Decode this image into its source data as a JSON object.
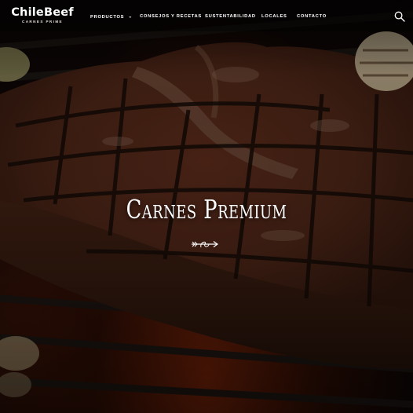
{
  "brand": {
    "name": "ChileBeef",
    "tagline": "CARNES PRIME"
  },
  "nav": {
    "items": [
      {
        "label": "PRODUCTOS",
        "has_dropdown": true
      },
      {
        "label": "CONSEJOS Y RECETAS",
        "has_dropdown": false
      },
      {
        "label": "SUSTENTABILIDAD",
        "has_dropdown": false
      },
      {
        "label": "LOCALES",
        "has_dropdown": false
      },
      {
        "label": "CONTACTO",
        "has_dropdown": false
      }
    ],
    "dropdown_icon": "chevron-down-icon",
    "search_icon": "search-icon"
  },
  "hero": {
    "title": "Carnes Premium",
    "ornament_icon": "arrow-flourish-icon",
    "background": "grilled-t-bone-steak-photo"
  },
  "colors": {
    "text": "#ffffff",
    "overlay": "#000000"
  }
}
